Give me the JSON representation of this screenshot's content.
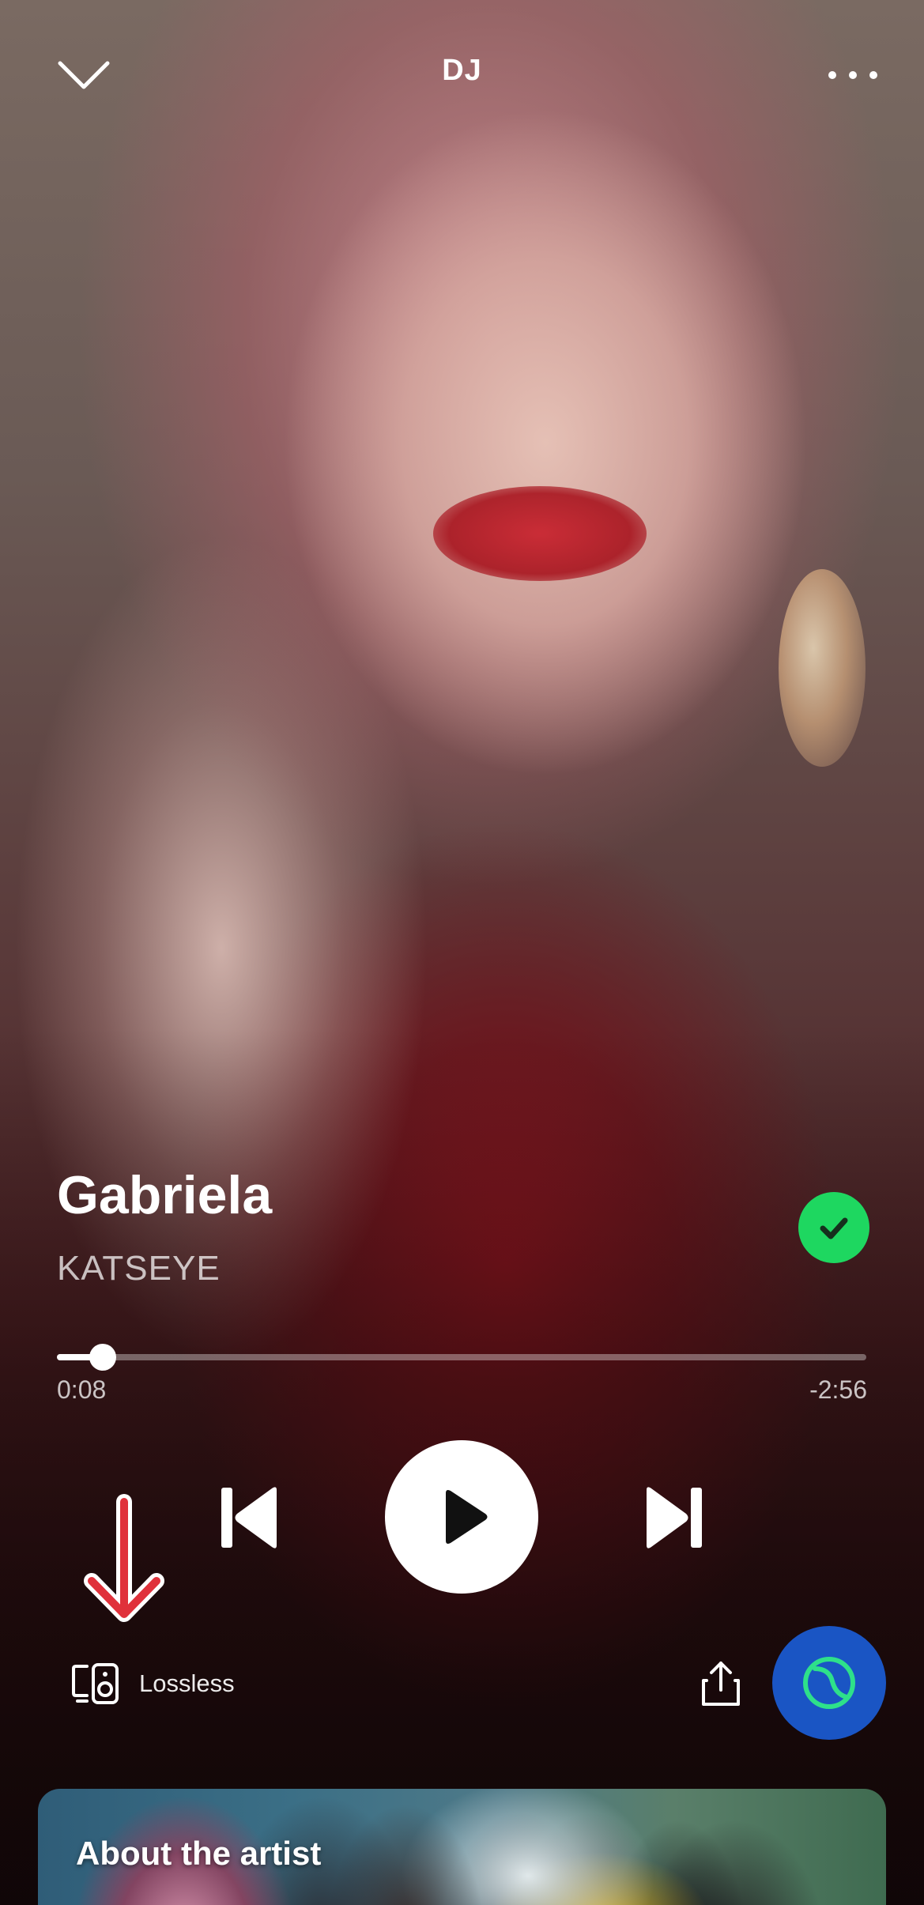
{
  "header": {
    "title": "DJ",
    "collapse_icon": "chevron-down-icon",
    "more_icon": "more-horizontal-icon"
  },
  "track": {
    "title": "Gabriela",
    "artist": "KATSEYE",
    "liked": true
  },
  "progress": {
    "elapsed": "0:08",
    "remaining": "-2:56",
    "fraction": 0.057
  },
  "controls": {
    "previous_icon": "skip-previous-icon",
    "play_icon": "play-icon",
    "next_icon": "skip-next-icon"
  },
  "bottom_bar": {
    "device_icon": "connect-device-icon",
    "device_label": "Lossless",
    "share_icon": "share-icon",
    "dj_icon": "dj-icon"
  },
  "about": {
    "title": "About the artist"
  },
  "colors": {
    "liked_green": "#1ed760",
    "dj_blue": "#1a55c4",
    "annotation_red": "#e0313b"
  }
}
